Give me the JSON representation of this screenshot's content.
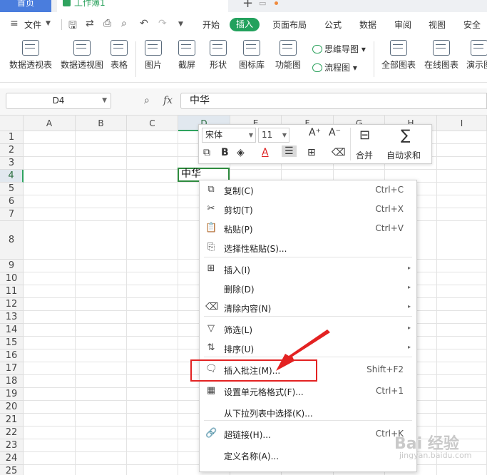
{
  "tabs": {
    "home": "首页",
    "workbook": "工作簿1"
  },
  "menu": {
    "file": "文件",
    "items": [
      "开始",
      "插入",
      "页面布局",
      "公式",
      "数据",
      "审阅",
      "视图",
      "安全"
    ],
    "active_index": 1
  },
  "ribbon": {
    "buttons": [
      "数据透视表",
      "数据透视图",
      "表格",
      "图片",
      "截屏",
      "形状",
      "图标库",
      "功能图",
      "全部图表",
      "在线图表",
      "演示图"
    ],
    "small": [
      "思维导图",
      "流程图"
    ]
  },
  "formula_bar": {
    "name_box": "D4",
    "fx": "fx",
    "content": "中华"
  },
  "grid": {
    "columns": [
      "A",
      "B",
      "C",
      "D",
      "E",
      "F",
      "G",
      "H",
      "I"
    ],
    "rows": [
      "1",
      "2",
      "3",
      "4",
      "5",
      "6",
      "7",
      "8",
      "9",
      "10",
      "11",
      "12",
      "13",
      "14",
      "15",
      "16",
      "17",
      "18",
      "19",
      "20",
      "21",
      "22",
      "23",
      "24",
      "25"
    ],
    "active_cell_value": "中华"
  },
  "mini_toolbar": {
    "font": "宋体",
    "size": "11",
    "grow": "A⁺",
    "shrink": "A⁻",
    "merge": "合并",
    "autosum": "自动求和"
  },
  "context_menu": [
    {
      "label": "复制(C)",
      "shortcut": "Ctrl+C",
      "icon": "copy-icon",
      "submenu": false
    },
    {
      "label": "剪切(T)",
      "shortcut": "Ctrl+X",
      "icon": "scissors-icon",
      "submenu": false
    },
    {
      "label": "粘贴(P)",
      "shortcut": "Ctrl+V",
      "icon": "paste-icon",
      "submenu": false
    },
    {
      "label": "选择性粘贴(S)...",
      "shortcut": "",
      "icon": "paste-special-icon",
      "submenu": false
    },
    {
      "label": "插入(I)",
      "shortcut": "",
      "icon": "insert-icon",
      "submenu": true
    },
    {
      "label": "删除(D)",
      "shortcut": "",
      "icon": "",
      "submenu": true
    },
    {
      "label": "清除内容(N)",
      "shortcut": "",
      "icon": "eraser-icon",
      "submenu": true
    },
    {
      "label": "筛选(L)",
      "shortcut": "",
      "icon": "filter-icon",
      "submenu": true
    },
    {
      "label": "排序(U)",
      "shortcut": "",
      "icon": "sort-icon",
      "submenu": true
    },
    {
      "label": "插入批注(M)...",
      "shortcut": "Shift+F2",
      "icon": "comment-icon",
      "submenu": false
    },
    {
      "label": "设置单元格格式(F)...",
      "shortcut": "Ctrl+1",
      "icon": "format-cells-icon",
      "submenu": false
    },
    {
      "label": "从下拉列表中选择(K)...",
      "shortcut": "",
      "icon": "",
      "submenu": false
    },
    {
      "label": "超链接(H)...",
      "shortcut": "Ctrl+K",
      "icon": "link-icon",
      "submenu": false
    },
    {
      "label": "定义名称(A)...",
      "shortcut": "",
      "icon": "",
      "submenu": false
    }
  ],
  "colors": {
    "accent_green": "#23a15d",
    "highlight_red": "#e32222",
    "tab_blue": "#4a7ddd"
  },
  "watermark": {
    "main": "Bai 经验",
    "sub": "jingyan.baidu.com"
  }
}
